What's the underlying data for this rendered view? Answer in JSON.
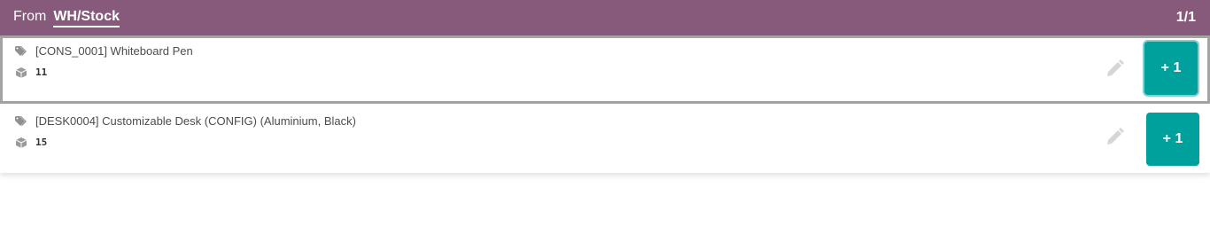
{
  "header": {
    "from_label": "From",
    "location": "WH/Stock",
    "page_counter": "1/1"
  },
  "lines": [
    {
      "product": "[CONS_0001] Whiteboard Pen",
      "quantity": "11",
      "plus_label": "+ 1",
      "selected": true
    },
    {
      "product": "[DESK0004] Customizable Desk (CONFIG) (Aluminium, Black)",
      "quantity": "15",
      "plus_label": "+ 1",
      "selected": false
    }
  ],
  "colors": {
    "header_bg": "#875a7b",
    "accent": "#00a09d",
    "icon": "#8f8f8f",
    "edit_icon": "#d6d6d6"
  },
  "icons": {
    "product": "tags-icon",
    "quantity": "cube-icon",
    "edit": "pencil-icon"
  }
}
